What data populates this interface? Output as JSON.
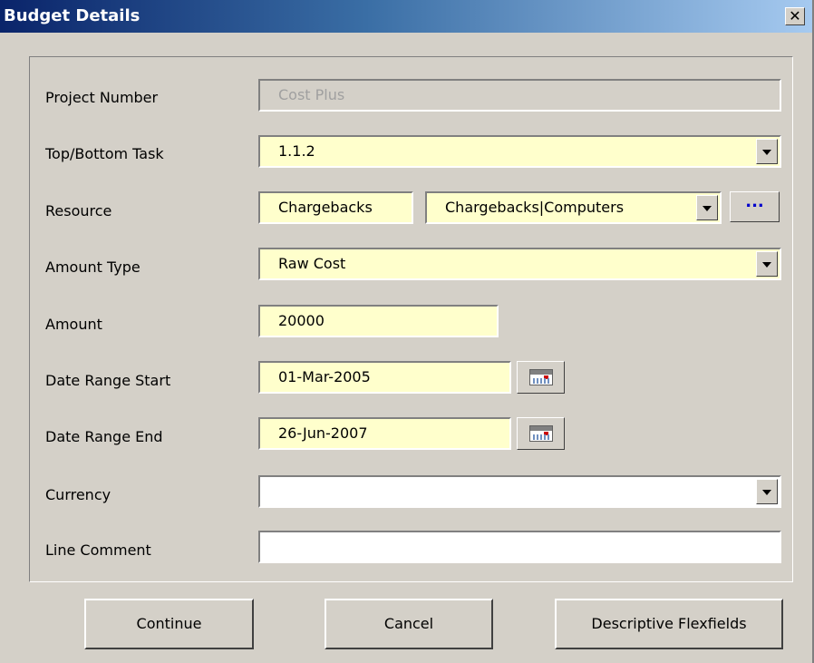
{
  "window": {
    "title": "Budget Details",
    "close_glyph": "✕"
  },
  "form": {
    "project_number": {
      "label": "Project Number",
      "value": "Cost Plus"
    },
    "task": {
      "label": "Top/Bottom Task",
      "value": "1.1.2"
    },
    "resource": {
      "label": "Resource",
      "value_short": "Chargebacks",
      "value_full": "Chargebacks|Computers",
      "lookup_label": "..."
    },
    "amount_type": {
      "label": "Amount Type",
      "value": "Raw Cost"
    },
    "amount": {
      "label": "Amount",
      "value": "20000"
    },
    "date_start": {
      "label": "Date Range Start",
      "value": "01-Mar-2005"
    },
    "date_end": {
      "label": "Date Range End",
      "value": "26-Jun-2007"
    },
    "currency": {
      "label": "Currency",
      "value": ""
    },
    "line_comment": {
      "label": "Line Comment",
      "value": ""
    }
  },
  "buttons": {
    "continue": "Continue",
    "cancel": "Cancel",
    "flexfields": "Descriptive Flexfields"
  },
  "icons": {
    "dropdown": "chevron-down-icon",
    "calendar": "calendar-icon",
    "close": "close-icon"
  },
  "colors": {
    "dialog_bg": "#d4d0c8",
    "required_field_bg": "#ffffcc",
    "title_gradient_start": "#0a246a",
    "title_gradient_end": "#a6caf0"
  }
}
